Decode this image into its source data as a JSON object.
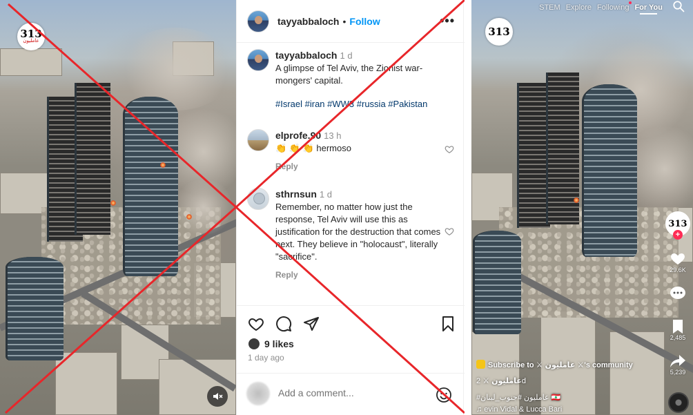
{
  "left_image": {
    "logo": {
      "number": "313",
      "subtext": "عامليون"
    }
  },
  "instagram": {
    "header": {
      "username": "tayyabbaloch",
      "separator": "•",
      "follow_label": "Follow",
      "more_label": "•••"
    },
    "caption": {
      "username": "tayyabbaloch",
      "time": "1 d",
      "text": "A glimpse of Tel Aviv, the Zionist war-mongers' capital.",
      "hashtags": "#Israel #iran #WW3 #russia #Pakistan"
    },
    "comments": [
      {
        "username": "elprofe.90",
        "time": "13 h",
        "text": "👏 👏 👏 hermoso",
        "reply_label": "Reply"
      },
      {
        "username": "sthrnsun",
        "time": "1 d",
        "text": "Remember, no matter how just the response, Tel Aviv will use this as justification for the destruction that comes next. They believe in \"holocaust\", literally \"sacrifice\".",
        "reply_label": "Reply"
      }
    ],
    "likes_label": "9 likes",
    "date_label": "1 day ago",
    "add_comment_placeholder": "Add a comment..."
  },
  "tiktok": {
    "nav_tabs": [
      "STEM",
      "Explore",
      "Following",
      "For You"
    ],
    "logo": {
      "number": "313"
    },
    "like_count": "29.6K",
    "share_count": "5,239",
    "bookmark_count": "2,485",
    "subscribe_text": "Subscribe to ⚔ عامليون ⚔'s community",
    "author_line": "عامليون ⚔",
    "author_time": "2d",
    "hashtags_line": "#عامليون #جنوب_لبنان 🇱🇧",
    "music_line": "♫ evin Vidal & Lucca Bari"
  },
  "colors": {
    "x_red": "#e8262a",
    "ig_blue": "#0095f6",
    "tiktok_pink": "#fe2c55"
  }
}
